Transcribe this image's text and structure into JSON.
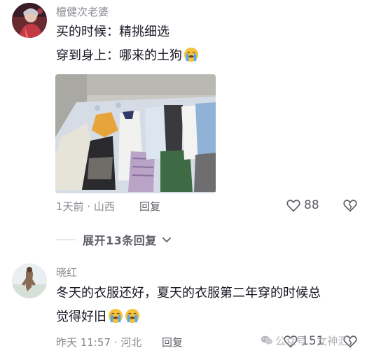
{
  "comments": [
    {
      "username": "檀健次老婆",
      "lines": [
        "买的时候：精挑细选",
        "穿到身上：哪来的土狗"
      ],
      "time": "1天前 · 山西",
      "reply_label": "回复",
      "likes": "88",
      "expand_label": "展开13条回复"
    },
    {
      "username": "晓红",
      "lines": [
        "冬天的衣服还好，夏天的衣服第二年穿的时候总",
        "觉得好旧"
      ],
      "time": "昨天 11:57 · 河北",
      "reply_label": "回复",
      "likes": "151"
    }
  ],
  "watermark": "公众号 · 女神汇",
  "icons": {
    "like": "heart-outline-icon",
    "dislike": "broken-heart-icon",
    "expand": "chevron-down-icon",
    "emoji": "loudly-crying-face-icon"
  },
  "colors": {
    "text": "#161823",
    "secondary": "#8a8b91",
    "emoji_yellow": "#f7c33d"
  }
}
